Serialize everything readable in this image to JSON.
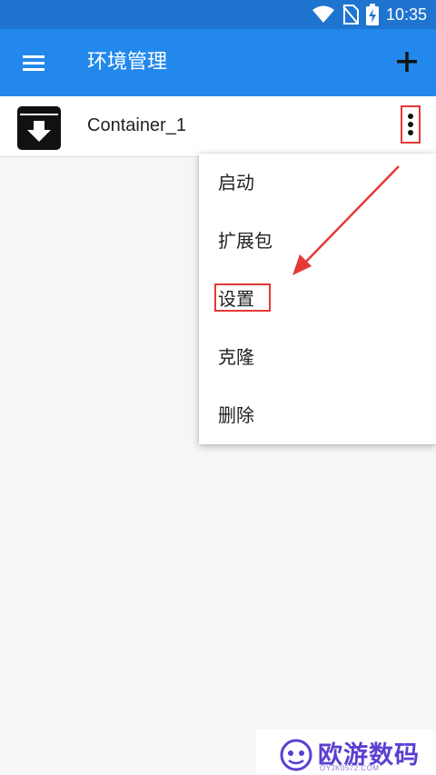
{
  "status_bar": {
    "time": "10:35",
    "icons": [
      "wifi-icon",
      "no-sim-icon",
      "battery-charging-icon"
    ]
  },
  "app_bar": {
    "title": "环境管理",
    "menu_icon": "hamburger-menu-icon",
    "add_icon": "plus-icon"
  },
  "containers": [
    {
      "name": "Container_1",
      "icon": "archive-box-icon",
      "more_icon": "more-vertical-icon"
    }
  ],
  "context_menu": {
    "items": [
      "启动",
      "扩展包",
      "设置",
      "克隆",
      "删除"
    ],
    "highlighted": "设置"
  },
  "colors": {
    "status_bar": "#1e74cf",
    "app_bar": "#2388ec",
    "annotation_red": "#e53935",
    "watermark_purple": "#5b3fd1"
  },
  "watermark": {
    "text": "欧游数码",
    "subtext": "OYJK0572.COM"
  }
}
